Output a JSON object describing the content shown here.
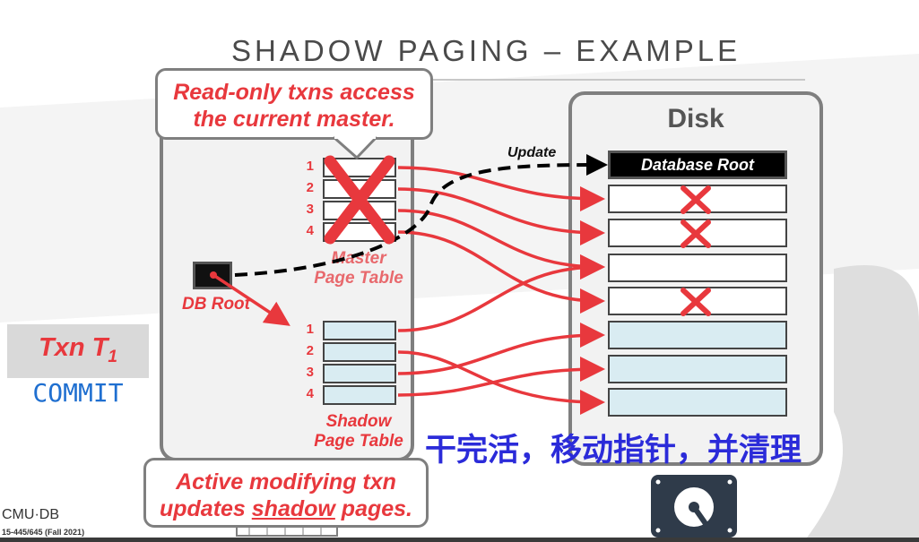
{
  "title": "SHADOW PAGING – EXAMPLE",
  "callouts": {
    "top_line1": "Read-only txns access",
    "top_line2": "the current master.",
    "bottom_line1": "Active modifying txn",
    "bottom_line2_pre": "updates ",
    "bottom_line2_underlined": "shadow",
    "bottom_line2_post": " pages."
  },
  "memory": {
    "master_rows": [
      "1",
      "2",
      "3",
      "4"
    ],
    "master_label_line1": "Master",
    "master_label_line2": "Page Table",
    "db_root_label": "DB Root",
    "shadow_rows": [
      "1",
      "2",
      "3",
      "4"
    ],
    "shadow_label_line1": "Shadow",
    "shadow_label_line2": "Page Table"
  },
  "disk": {
    "title": "Disk",
    "db_root_block": "Database Root",
    "update_label": "Update",
    "pages": [
      {
        "style": "white",
        "crossed": true
      },
      {
        "style": "white",
        "crossed": true
      },
      {
        "style": "white",
        "crossed": false
      },
      {
        "style": "white",
        "crossed": true
      },
      {
        "style": "blue",
        "crossed": false
      },
      {
        "style": "blue",
        "crossed": false
      },
      {
        "style": "blue",
        "crossed": false
      }
    ]
  },
  "txn": {
    "label": "Txn T",
    "subscript": "1",
    "status": "COMMIT"
  },
  "annotation": "干完活，移动指针，并清理",
  "footer": {
    "logo": "CMU·DB",
    "course": "15-445/645 (Fall 2021)"
  },
  "colors": {
    "accent_red": "#e8383d",
    "commit_blue": "#1f6fd0",
    "annotation_blue": "#2b2bd9",
    "shadow_fill": "#d9ecf2"
  }
}
